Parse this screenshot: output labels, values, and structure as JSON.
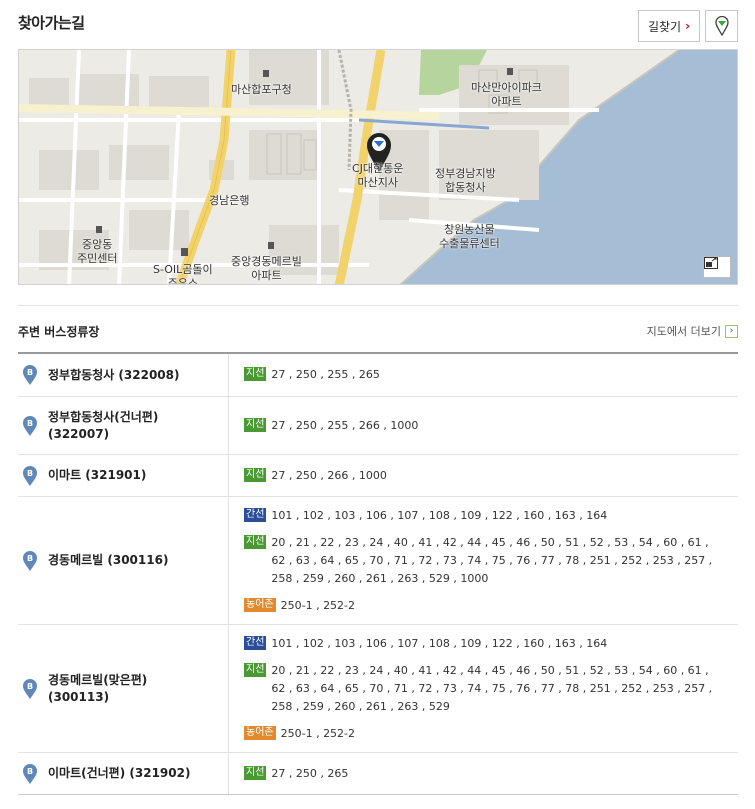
{
  "page": {
    "title": "찾아가는길"
  },
  "toolbar": {
    "find_route_label": "길찾기",
    "find_route_arrow": "›"
  },
  "map": {
    "labels": {
      "masan_hapo_office": "마산합포구청",
      "masan_bay_apt": "마산만아이파크\n아파트",
      "cj_korea_express": "CJ대한통운\n마산지사",
      "gov_complex": "정부경남지방\n합동청사",
      "gyeongnam_bank": "경남은행",
      "jungang_center": "중앙동\n주민센터",
      "soil_station": "S-OIL곰돌이\n주유소",
      "jungang_apt": "중앙경동메르빌\n아파트",
      "changwon_center": "창원농산물\n수출물류센터"
    }
  },
  "section": {
    "title": "주변 버스정류장",
    "more_label": "지도에서 더보기",
    "more_icon": "›"
  },
  "badges": {
    "green": "지선",
    "blue": "간선",
    "orange": "농어촌"
  },
  "stops": [
    {
      "name": "정부합동청사 (322008)",
      "routes": [
        {
          "type": "green",
          "numbers": "27 , 250 , 255 , 265"
        }
      ]
    },
    {
      "name": "정부합동청사(건너편)\n(322007)",
      "routes": [
        {
          "type": "green",
          "numbers": "27 , 250 , 255 , 266 , 1000"
        }
      ]
    },
    {
      "name": "이마트 (321901)",
      "routes": [
        {
          "type": "green",
          "numbers": "27 , 250 , 266 , 1000"
        }
      ]
    },
    {
      "name": "경동메르빌 (300116)",
      "routes": [
        {
          "type": "blue",
          "numbers": "101 , 102 , 103 , 106 , 107 , 108 , 109 , 122 , 160 , 163 , 164"
        },
        {
          "type": "green",
          "numbers": "20 , 21 , 22 , 23 , 24 , 40 , 41 , 42 , 44 , 45 , 46 , 50 , 51 , 52 , 53 , 54 , 60 , 61 , 62 , 63 , 64 , 65 , 70 , 71 , 72 , 73 , 74 , 75 , 76 , 77 , 78 , 251 , 252 , 253 , 257 , 258 , 259 , 260 , 261 , 263 , 529 , 1000"
        },
        {
          "type": "orange",
          "numbers": "250-1 , 252-2"
        }
      ]
    },
    {
      "name": "경동메르빌(맞은편)\n(300113)",
      "routes": [
        {
          "type": "blue",
          "numbers": "101 , 102 , 103 , 106 , 107 , 108 , 109 , 122 , 160 , 163 , 164"
        },
        {
          "type": "green",
          "numbers": "20 , 21 , 22 , 23 , 24 , 40 , 41 , 42 , 44 , 45 , 46 , 50 , 51 , 52 , 53 , 54 , 60 , 61 , 62 , 63 , 64 , 65 , 70 , 71 , 72 , 73 , 74 , 75 , 76 , 77 , 78 , 251 , 252 , 253 , 257 , 258 , 259 , 260 , 261 , 263 , 529"
        },
        {
          "type": "orange",
          "numbers": "250-1 , 252-2"
        }
      ]
    },
    {
      "name": "이마트(건너편) (321902)",
      "routes": [
        {
          "type": "green",
          "numbers": "27 , 250 , 265"
        }
      ]
    }
  ],
  "colors": {
    "green": "#4a9a34",
    "blue": "#2a4e9a",
    "orange": "#e08a2c",
    "sea": "#a6bdd6",
    "road_main": "#f2d36b"
  }
}
